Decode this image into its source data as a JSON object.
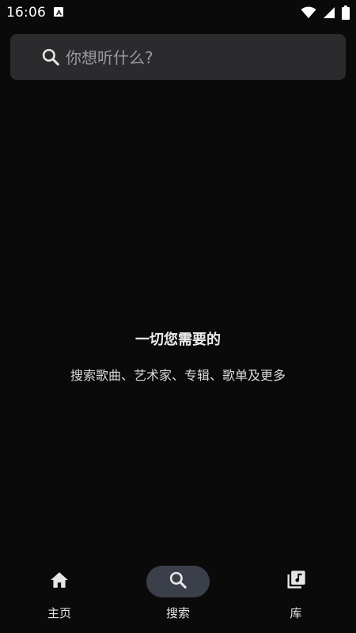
{
  "status_bar": {
    "time": "16:06",
    "icons": [
      "text-a-icon",
      "wifi-icon",
      "signal-icon",
      "battery-icon"
    ]
  },
  "search": {
    "placeholder": "你想听什么?"
  },
  "empty_state": {
    "title": "一切您需要的",
    "subtitle": "搜索歌曲、艺术家、专辑、歌单及更多"
  },
  "bottom_nav": {
    "items": [
      {
        "label": "主页",
        "icon": "home-icon",
        "active": false
      },
      {
        "label": "搜索",
        "icon": "search-icon",
        "active": true
      },
      {
        "label": "库",
        "icon": "library-icon",
        "active": false
      }
    ],
    "active_pill_color": "#3b3f4a"
  },
  "colors": {
    "background": "#0a0a0b",
    "search_bar": "#2b2b2d",
    "placeholder": "#9a9a9c"
  }
}
